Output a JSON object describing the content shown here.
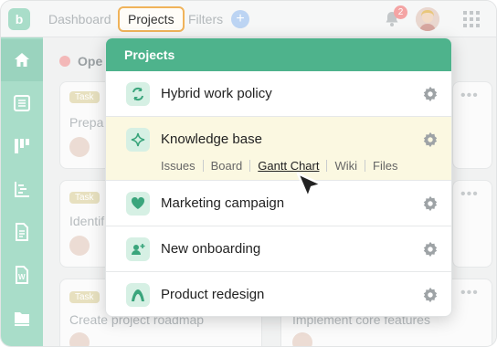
{
  "topbar": {
    "logo_letter": "b",
    "nav": [
      "Dashboard",
      "Projects",
      "Filters"
    ],
    "notifications_count": "2"
  },
  "board": {
    "column_title": "Ope",
    "cards": [
      {
        "tag": "Task",
        "title": "Prepa"
      },
      {
        "tag": "Task",
        "title": "Identif"
      },
      {
        "tag": "Task",
        "title": "Create project roadmap"
      },
      {
        "tag": "Task",
        "title": "Implement core features"
      }
    ]
  },
  "dropdown": {
    "header": "Projects",
    "projects": [
      {
        "name": "Hybrid work policy",
        "icon": "sync-icon"
      },
      {
        "name": "Knowledge base",
        "icon": "sparkle-icon",
        "links": [
          "Issues",
          "Board",
          "Gantt Chart",
          "Wiki",
          "Files"
        ],
        "active_link": "Gantt Chart"
      },
      {
        "name": "Marketing campaign",
        "icon": "heart-icon"
      },
      {
        "name": "New onboarding",
        "icon": "add-user-icon"
      },
      {
        "name": "Product redesign",
        "icon": "arch-icon"
      }
    ]
  },
  "colors": {
    "accent": "#4eb38c",
    "sidebar": "#a9ddc9",
    "highlight": "#fbf8e1",
    "focus_outline": "#f0b35a"
  }
}
